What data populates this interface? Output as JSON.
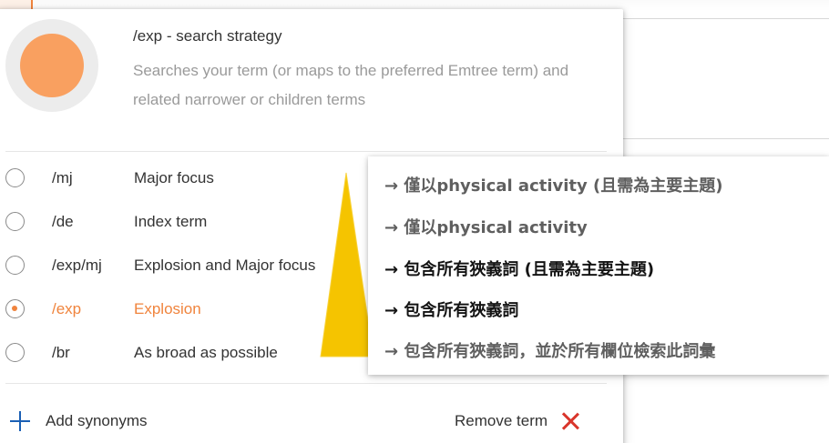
{
  "strategy": {
    "icon": "circle-avatar-icon",
    "title": "/exp - search strategy",
    "description": "Searches your term (or maps to the preferred Emtree term) and related narrower or children terms"
  },
  "options": [
    {
      "code": "/mj",
      "label": "Major focus",
      "selected": false
    },
    {
      "code": "/de",
      "label": "Index term",
      "selected": false
    },
    {
      "code": "/exp/mj",
      "label": "Explosion and Major focus",
      "selected": false
    },
    {
      "code": "/exp",
      "label": "Explosion",
      "selected": true
    },
    {
      "code": "/br",
      "label": "As broad as possible",
      "selected": false
    }
  ],
  "actions": {
    "add_synonyms": "Add synonyms",
    "remove_term": "Remove term"
  },
  "annotations": [
    "→ 僅以physical activity (且需為主要主題)",
    "→ 僅以physical activity",
    "→ 包含所有狹義詞 (且需為主要主題)",
    "→ 包含所有狹義詞",
    "→ 包含所有狹義詞，並於所有欄位檢索此詞彙"
  ],
  "colors": {
    "accent": "#f0843d",
    "avatar": "#f9a060",
    "plus": "#1a5fb4",
    "remove": "#d9352b",
    "arrow": "#f5c400"
  }
}
